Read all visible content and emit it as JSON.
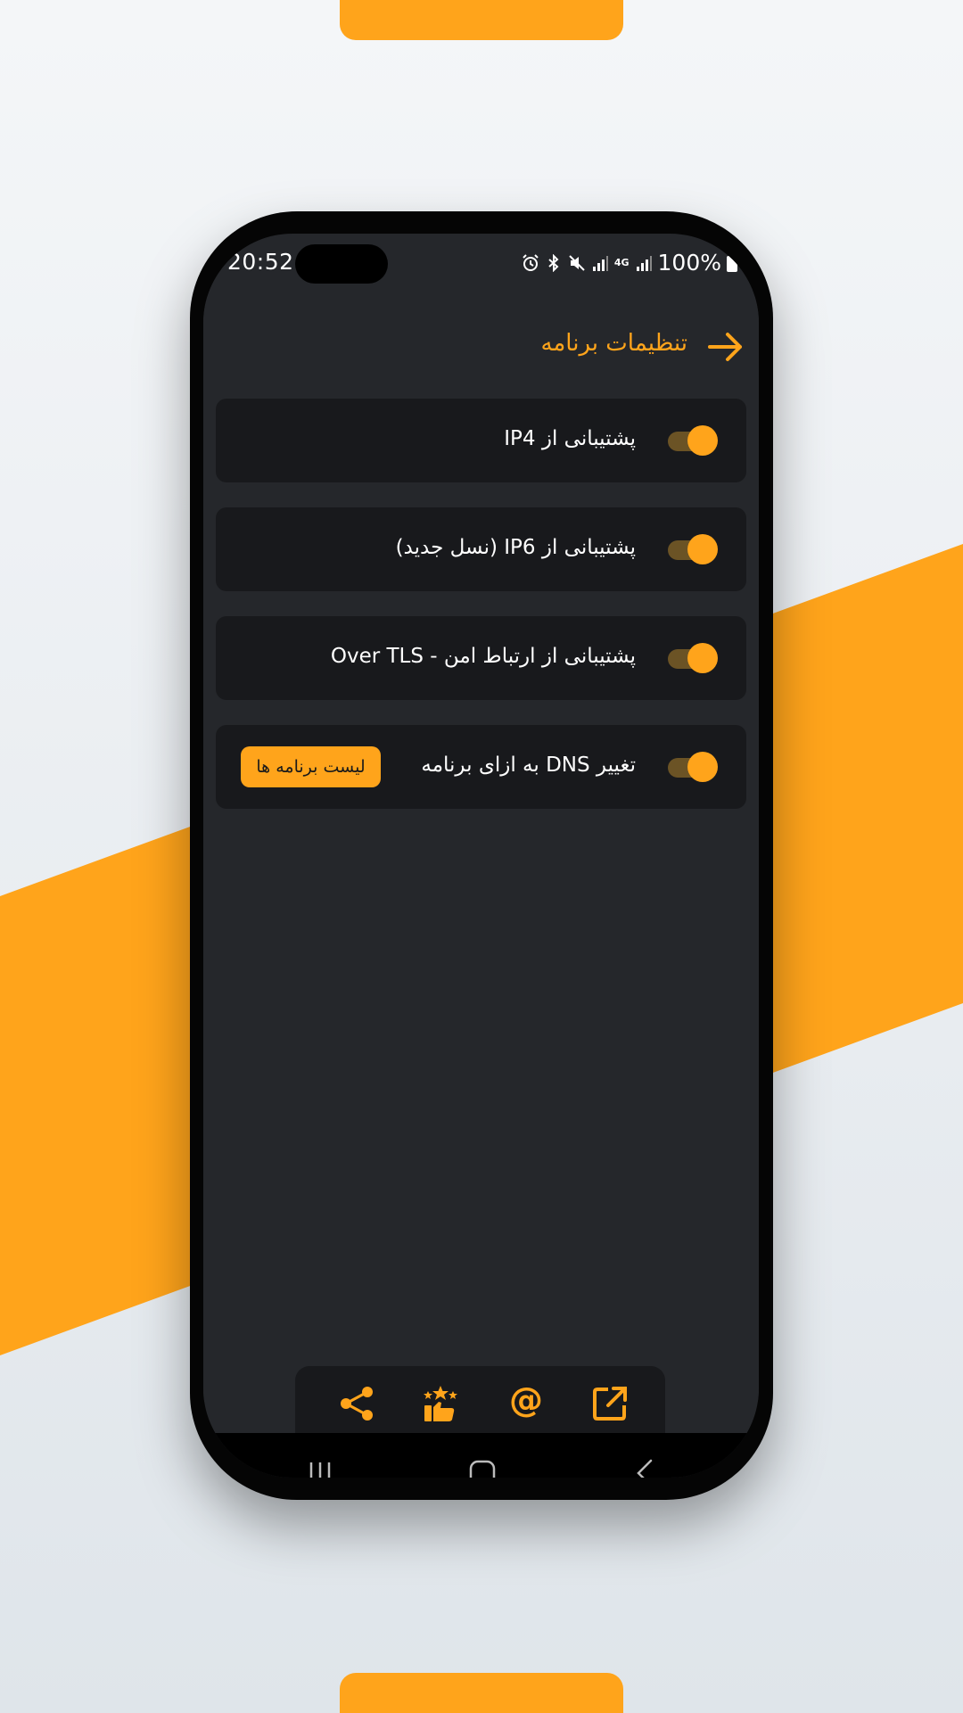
{
  "colors": {
    "accent": "#FFA41B",
    "screen_bg": "#25272b",
    "card_bg": "#18191c",
    "text": "#ffffff"
  },
  "status_bar": {
    "time": "20:52",
    "network": "4G",
    "battery": "100%",
    "icons": [
      "alarm-icon",
      "bluetooth-icon",
      "mute-icon",
      "signal-icon",
      "signal-icon",
      "battery-icon"
    ]
  },
  "app_bar": {
    "title": "تنظیمات برنامه",
    "back_icon": "arrow-right-icon"
  },
  "settings": [
    {
      "label": "پشتیبانی از IP4",
      "enabled": true
    },
    {
      "label": "پشتیبانی از IP6 (نسل جدید)",
      "enabled": true
    },
    {
      "label": "پشتیبانی از ارتباط امن - Over TLS",
      "enabled": true
    },
    {
      "label": "تغییر DNS به ازای برنامه",
      "enabled": true,
      "button": "لیست برنامه ها"
    }
  ],
  "toolbar": {
    "icons": [
      "share-icon",
      "rate-icon",
      "at-email-icon",
      "open-external-icon"
    ],
    "at_symbol": "@"
  },
  "nav_bar": {
    "icons": [
      "recent-apps-icon",
      "home-icon",
      "back-icon"
    ]
  }
}
